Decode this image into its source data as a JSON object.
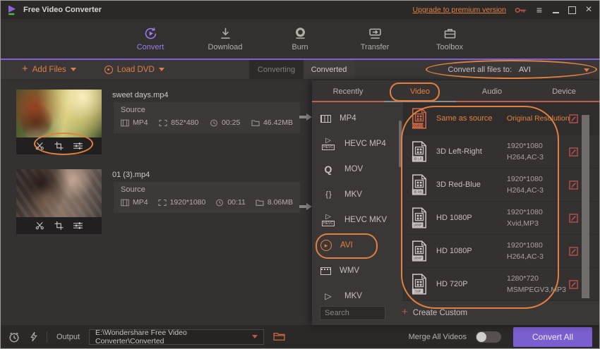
{
  "titlebar": {
    "app_title": "Free Video Converter",
    "upgrade_link": "Upgrade to premium version"
  },
  "nav": {
    "items": [
      {
        "label": "Convert",
        "active": true
      },
      {
        "label": "Download"
      },
      {
        "label": "Burn"
      },
      {
        "label": "Transfer"
      },
      {
        "label": "Toolbox"
      }
    ]
  },
  "toolbar": {
    "add_files": "Add Files",
    "load_dvd": "Load DVD",
    "tab_converting": "Converting",
    "tab_converted": "Converted",
    "convert_all_label": "Convert all files to:",
    "convert_all_value": "AVI"
  },
  "files": [
    {
      "name": "sweet days.mp4",
      "source_label": "Source",
      "format": "MP4",
      "resolution": "852*480",
      "duration": "00:25",
      "size": "46.42MB"
    },
    {
      "name": "01 (3).mp4",
      "source_label": "Source",
      "format": "MP4",
      "resolution": "1920*1080",
      "duration": "00:11",
      "size": "8.06MB"
    }
  ],
  "panel": {
    "tabs": [
      "Recently",
      "Video",
      "Audio",
      "Device"
    ],
    "formats": [
      {
        "label": "MP4"
      },
      {
        "label": "HEVC MP4"
      },
      {
        "label": "MOV"
      },
      {
        "label": "MKV"
      },
      {
        "label": "HEVC MKV"
      },
      {
        "label": "AVI",
        "active": true
      },
      {
        "label": "WMV"
      },
      {
        "label": "MKV"
      }
    ],
    "rows": [
      {
        "badge": "SOURCE",
        "name": "Same as source",
        "spec1": "Original Resolution",
        "spec2": ""
      },
      {
        "badge": "3D LR",
        "name": "3D Left-Right",
        "spec1": "1920*1080",
        "spec2": "H264,AC-3"
      },
      {
        "badge": "3D RB",
        "name": "3D Red-Blue",
        "spec1": "1920*1080",
        "spec2": "H264,AC-3"
      },
      {
        "badge": "1080P",
        "name": "HD 1080P",
        "spec1": "1920*1080",
        "spec2": "Xvid,MP3"
      },
      {
        "badge": "1080P",
        "name": "HD 1080P",
        "spec1": "1920*1080",
        "spec2": "H264,AC-3"
      },
      {
        "badge": "720P",
        "name": "HD 720P",
        "spec1": "1280*720",
        "spec2": "MSMPEGV3,MP3"
      }
    ],
    "search_placeholder": "Search",
    "create_custom": "Create Custom"
  },
  "bottombar": {
    "output_label": "Output",
    "output_path": "E:\\Wondershare Free Video Converter\\Converted",
    "merge_label": "Merge All Videos",
    "convert_all_button": "Convert All"
  },
  "colors": {
    "accent_purple": "#7a5fd0",
    "accent_orange": "#e0813f",
    "link_orange": "#e2833f",
    "tab_underline_red": "#bf5f53"
  }
}
